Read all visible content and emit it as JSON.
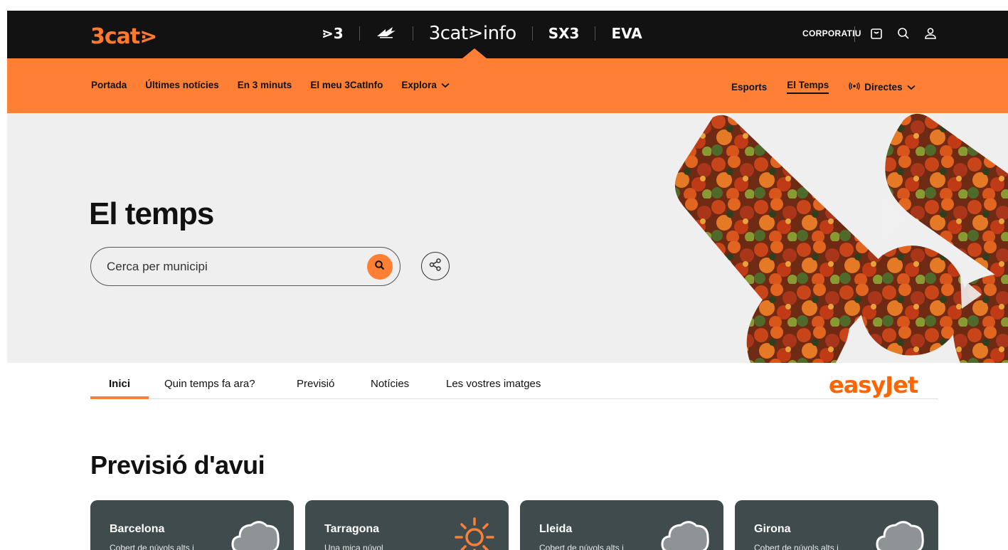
{
  "topbar": {
    "logo": "3cat⋗",
    "brands": [
      {
        "label": "⋗3",
        "icon": ""
      },
      {
        "label": "",
        "icon": "catradio-icon"
      },
      {
        "label": "3cat⋗info",
        "icon": ""
      },
      {
        "label": "SX3",
        "icon": ""
      },
      {
        "label": "EVA",
        "icon": ""
      }
    ],
    "corporate_label": "CORPORATIU",
    "icons": [
      "cart-icon",
      "search-icon",
      "user-icon"
    ]
  },
  "nav": {
    "left": [
      "Portada",
      "Últimes notícies",
      "En 3 minuts",
      "El meu 3CatInfo"
    ],
    "explore_label": "Explora",
    "right": [
      "Esports",
      "El Temps"
    ],
    "live_label": "Directes",
    "current": "El Temps"
  },
  "hero": {
    "title": "El temps",
    "search_placeholder": "Cerca per municipi"
  },
  "tabs": {
    "items": [
      "Inici",
      "Quin temps fa ara?",
      "Previsió",
      "Notícies",
      "Les vostres imatges"
    ],
    "active": "Inici"
  },
  "sponsor": "easyJet",
  "forecast": {
    "title": "Previsió d'avui",
    "cards": [
      {
        "city": "Barcelona",
        "desc": "Cobert de núvols alts i",
        "icon": "cloud-icon"
      },
      {
        "city": "Tarragona",
        "desc": "Una mica núvol",
        "icon": "sun-icon"
      },
      {
        "city": "Lleida",
        "desc": "Cobert de núvols alts i",
        "icon": "cloud-icon"
      },
      {
        "city": "Girona",
        "desc": "Cobert de núvols alts i",
        "icon": "cloud-icon"
      }
    ]
  },
  "colors": {
    "accent": "#ff7f35",
    "topbar": "#121212",
    "card": "#3f4b4d"
  }
}
